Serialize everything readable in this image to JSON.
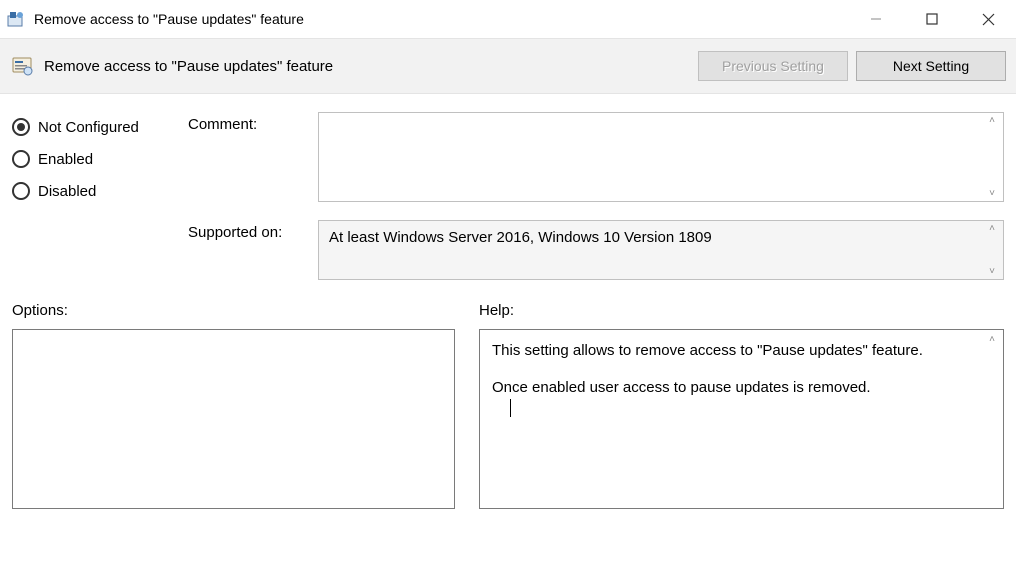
{
  "window": {
    "title": "Remove access to \"Pause updates\" feature"
  },
  "toolbar": {
    "policy_title": "Remove access to \"Pause updates\" feature",
    "prev_label": "Previous Setting",
    "next_label": "Next Setting"
  },
  "state": {
    "not_configured": "Not Configured",
    "enabled": "Enabled",
    "disabled": "Disabled",
    "selected": "not_configured"
  },
  "fields": {
    "comment_label": "Comment:",
    "comment_value": "",
    "supported_label": "Supported on:",
    "supported_value": "At least Windows Server 2016, Windows 10 Version 1809"
  },
  "lower": {
    "options_label": "Options:",
    "help_label": "Help:",
    "help_line1": "This setting allows to remove access to \"Pause updates\" feature.",
    "help_line2": "Once enabled user access to pause updates is removed."
  }
}
